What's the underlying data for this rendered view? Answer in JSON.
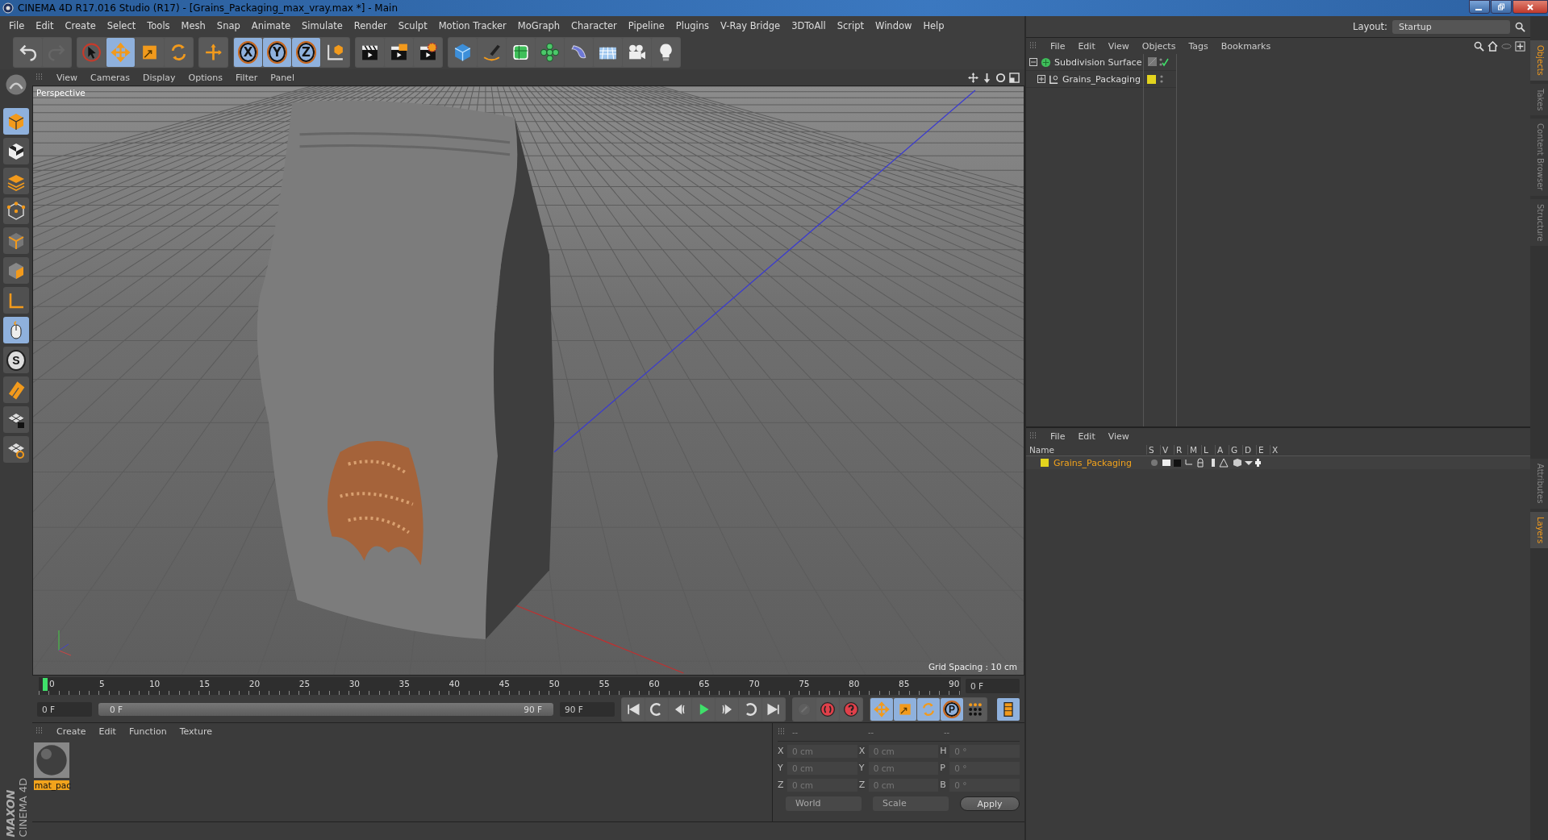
{
  "window": {
    "title": "CINEMA 4D R17.016 Studio (R17) - [Grains_Packaging_max_vray.max *] - Main"
  },
  "menu": [
    "File",
    "Edit",
    "Create",
    "Select",
    "Tools",
    "Mesh",
    "Snap",
    "Animate",
    "Simulate",
    "Render",
    "Sculpt",
    "Motion Tracker",
    "MoGraph",
    "Character",
    "Pipeline",
    "Plugins",
    "V-Ray Bridge",
    "3DToAll",
    "Script",
    "Window",
    "Help"
  ],
  "layout": {
    "label": "Layout:",
    "value": "Startup"
  },
  "toolbar": [
    [
      {
        "kind": "undo",
        "selected": false
      },
      {
        "kind": "redo",
        "selected": false
      }
    ],
    [
      {
        "kind": "pointer",
        "selected": false
      },
      {
        "kind": "move",
        "selected": true
      },
      {
        "kind": "scale",
        "selected": false
      },
      {
        "kind": "rotate",
        "selected": false
      }
    ],
    [
      {
        "kind": "transform",
        "selected": false
      }
    ],
    [
      {
        "kind": "axis",
        "label": "X",
        "selected": true
      },
      {
        "kind": "axis",
        "label": "Y",
        "selected": true
      },
      {
        "kind": "axis",
        "label": "Z",
        "selected": true
      },
      {
        "kind": "coords",
        "selected": false
      }
    ],
    [
      {
        "kind": "render-view",
        "selected": false
      },
      {
        "kind": "render-picture",
        "selected": false
      },
      {
        "kind": "render-settings",
        "selected": false
      }
    ],
    [
      {
        "kind": "cube",
        "selected": false
      },
      {
        "kind": "pen",
        "selected": false
      },
      {
        "kind": "subdivision",
        "selected": false
      },
      {
        "kind": "cloner",
        "selected": false
      },
      {
        "kind": "deformer",
        "selected": false
      },
      {
        "kind": "floor",
        "selected": false
      },
      {
        "kind": "camera",
        "selected": false
      },
      {
        "kind": "light",
        "selected": false
      }
    ]
  ],
  "left_toolbar": [
    {
      "kind": "model",
      "selected": true
    },
    {
      "kind": "texture",
      "selected": false
    },
    {
      "kind": "workplane",
      "selected": false
    },
    {
      "kind": "points",
      "selected": false
    },
    {
      "kind": "edges",
      "selected": false
    },
    {
      "kind": "polygons",
      "selected": false
    },
    {
      "kind": "object-axis",
      "selected": false
    },
    {
      "kind": "tweak",
      "selected": true
    },
    {
      "kind": "snap",
      "label": "S",
      "selected": false
    },
    {
      "kind": "magnet",
      "selected": false
    },
    {
      "kind": "lock",
      "selected": false
    },
    {
      "kind": "lock2",
      "selected": false
    }
  ],
  "brand": {
    "maker": "MAXON",
    "product": "CINEMA 4D"
  },
  "viewport": {
    "menu": [
      "View",
      "Cameras",
      "Display",
      "Options",
      "Filter",
      "Panel"
    ],
    "camera": "Perspective",
    "grid_spacing": "Grid Spacing : 10 cm"
  },
  "timeline": {
    "ticks": [
      "0",
      "5",
      "10",
      "15",
      "20",
      "25",
      "30",
      "35",
      "40",
      "45",
      "50",
      "55",
      "60",
      "65",
      "70",
      "75",
      "80",
      "85",
      "90"
    ],
    "playhead": {
      "level": 0
    },
    "current_frame": "0 F",
    "start": "0 F",
    "scrub_start": "0 F",
    "scrub_end": "90 F",
    "range": {
      "level": 1
    },
    "end": "90 F",
    "playback": [
      {
        "kind": "to-start"
      },
      {
        "kind": "prev-key"
      },
      {
        "kind": "prev-frame"
      },
      {
        "kind": "play"
      },
      {
        "kind": "next-frame"
      },
      {
        "kind": "next-key"
      },
      {
        "kind": "to-end"
      }
    ],
    "record": [
      {
        "kind": "keyframe",
        "disabled": true
      },
      {
        "kind": "autokey",
        "disabled": false
      },
      {
        "kind": "key-help",
        "disabled": false
      }
    ],
    "key_tracks": [
      {
        "kind": "move",
        "selected": true
      },
      {
        "kind": "scale",
        "selected": true
      },
      {
        "kind": "rotate",
        "selected": true
      },
      {
        "kind": "param",
        "label": "P",
        "selected": true
      },
      {
        "kind": "points",
        "selected": false
      }
    ],
    "timeline_button": {
      "selected": true
    }
  },
  "materials": {
    "menu": [
      "Create",
      "Edit",
      "Function",
      "Texture"
    ],
    "items": [
      {
        "name": "mat_pac",
        "selected": true
      }
    ]
  },
  "coordinates": {
    "headers": [
      "--",
      "--",
      "--"
    ],
    "rows": [
      {
        "axis": "X",
        "position": "0 cm",
        "size_axis": "X",
        "size": "0 cm",
        "rot_axis": "H",
        "rotation": "0 °"
      },
      {
        "axis": "Y",
        "position": "0 cm",
        "size_axis": "Y",
        "size": "0 cm",
        "rot_axis": "P",
        "rotation": "0 °"
      },
      {
        "axis": "Z",
        "position": "0 cm",
        "size_axis": "Z",
        "size": "0 cm",
        "rot_axis": "B",
        "rotation": "0 °"
      }
    ],
    "space": "World",
    "mode": "Scale",
    "apply": "Apply"
  },
  "objects": {
    "menu": [
      "File",
      "Edit",
      "View",
      "Objects",
      "Tags",
      "Bookmarks"
    ],
    "tree": [
      {
        "name": "Subdivision Surface",
        "kind": "subdivision",
        "expanded": true,
        "enabled": true,
        "children": [
          {
            "name": "Grains_Packaging",
            "kind": "null",
            "expanded": false,
            "color": "#e3d41e"
          }
        ]
      }
    ]
  },
  "layers": {
    "menu": [
      "File",
      "Edit",
      "View"
    ],
    "name_header": "Name",
    "flags": [
      "S",
      "V",
      "R",
      "M",
      "L",
      "A",
      "G",
      "D",
      "E",
      "X"
    ],
    "items": [
      {
        "name": "Grains_Packaging",
        "color": "#e3d41e"
      }
    ]
  },
  "side_tabs": [
    {
      "label": "Objects",
      "selected": true
    },
    {
      "label": "Takes",
      "selected": false
    },
    {
      "label": "Content Browser",
      "selected": false
    },
    {
      "label": "Structure",
      "selected": false
    },
    {
      "label": "Attributes",
      "selected": false
    },
    {
      "label": "Layers",
      "selected": true
    }
  ]
}
